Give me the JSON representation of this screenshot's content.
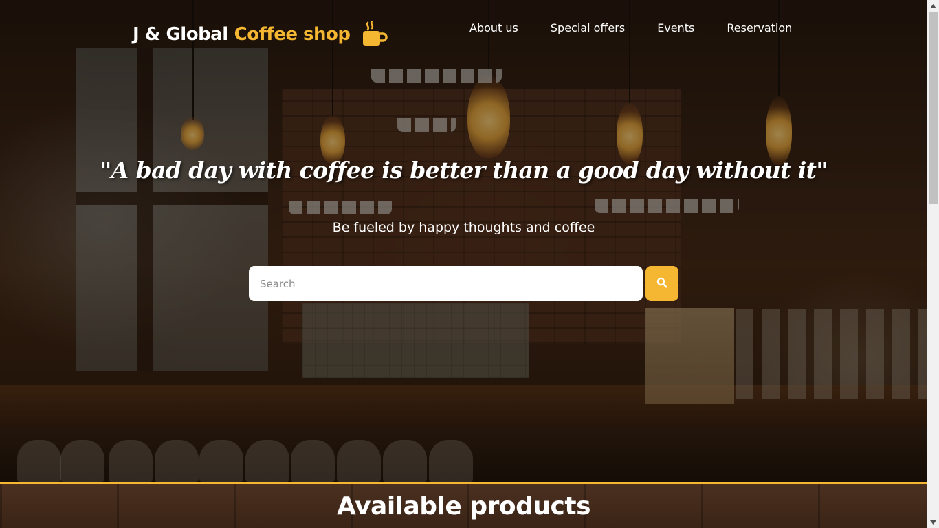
{
  "brand": {
    "name_white": "J & Global",
    "name_gold": "Coffee shop",
    "icon": "coffee-cup-icon"
  },
  "nav": {
    "items": [
      {
        "label": "About us"
      },
      {
        "label": "Special offers"
      },
      {
        "label": "Events"
      },
      {
        "label": "Reservation"
      }
    ]
  },
  "hero": {
    "quote": "\"A bad day with coffee is better than a good day without it\"",
    "subtitle": "Be fueled by happy thoughts and coffee"
  },
  "search": {
    "placeholder": "Search",
    "value": "",
    "button_icon": "search-icon"
  },
  "products": {
    "title": "Available products"
  },
  "colors": {
    "accent": "#f5b732",
    "text": "#ffffff",
    "scrollbar_track": "#f1f1f1",
    "scrollbar_thumb": "#c1c1c1"
  }
}
